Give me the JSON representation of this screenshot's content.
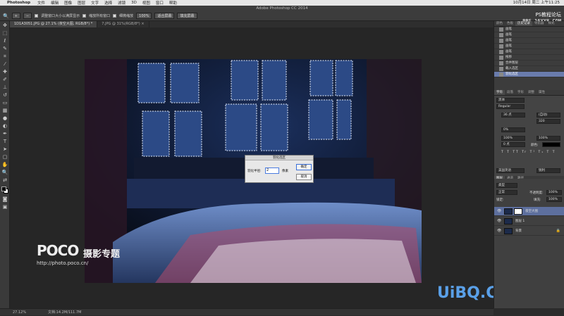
{
  "menubar": {
    "app_name": "Photoshop",
    "items": [
      "文件",
      "编辑",
      "图像",
      "图层",
      "文字",
      "选择",
      "滤镜",
      "3D",
      "视图",
      "窗口",
      "帮助"
    ],
    "clock": "10月14日 周二 上午11:25"
  },
  "window": {
    "title": "Adobe Photoshop CC 2014"
  },
  "options": {
    "resize_window_label": "调整窗口大小以满屏显示",
    "zoom_all_label": "缩放所有窗口",
    "scrubby_zoom_label": "细微缩放",
    "btn_100": "100%",
    "btn_fit": "适合屏幕",
    "btn_fill": "填充屏幕"
  },
  "watermark_top": {
    "line1": "PS教程论坛",
    "line2": "BBS.16XX8.COM"
  },
  "doc_tabs": [
    {
      "label": "1D1A3051.JPG @ 27.1% (夜空大图, RGB/8*) *"
    },
    {
      "label": "7.JPG @ 31%(RGB/8*) ×"
    }
  ],
  "dialog": {
    "title": "羽化选区",
    "radius_label": "羽化半径:",
    "radius_value": "2",
    "unit": "像素",
    "ok": "确定",
    "cancel": "取消"
  },
  "poco": {
    "brand": "POCO",
    "title": "摄影专题",
    "url": "http://photo.poco.cn/"
  },
  "status": {
    "zoom": "27.12%",
    "doc": "文档:14.2M/111.7M"
  },
  "watermark_bottom": "UiBQ.CoM",
  "history": {
    "tabs": [
      "颜色",
      "色板",
      "历史记录",
      "导航器",
      "样式"
    ],
    "items": [
      "画笔",
      "画笔",
      "画笔",
      "画笔",
      "画笔",
      "拖移",
      "合并图层",
      "载入选区",
      "羽化选区"
    ]
  },
  "character": {
    "tabs": [
      "字符",
      "段落",
      "字形",
      "调整",
      "属性"
    ],
    "font": "黑体",
    "style": "Regular",
    "size": "36 点",
    "leading": "(自动)",
    "tracking": "320",
    "kerning": "0%",
    "vscale": "100%",
    "hscale": "100%",
    "baseline": "0 点",
    "color_label": "颜色:",
    "lang": "美国英语",
    "aa": "锐利"
  },
  "layers": {
    "tabs": [
      "图层",
      "通道",
      "路径"
    ],
    "kind": "类型",
    "blend": "正常",
    "opacity_label": "不透明度:",
    "opacity": "100%",
    "lock_label": "锁定:",
    "fill_label": "填充:",
    "fill": "100%",
    "items": [
      "夜空大图",
      "图层 1",
      "背景"
    ]
  }
}
